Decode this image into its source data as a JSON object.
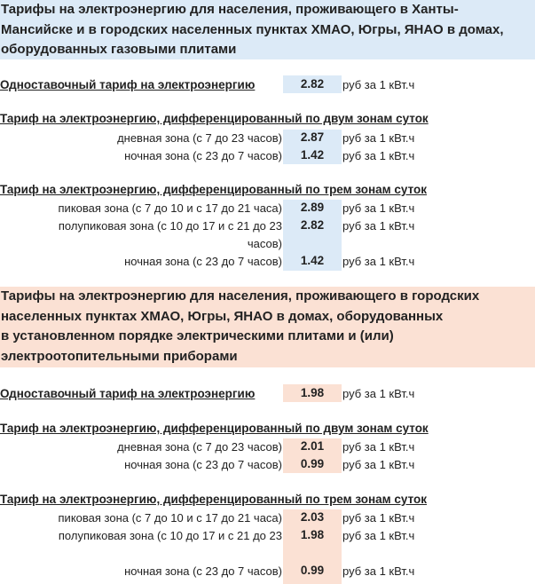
{
  "section1": {
    "title_lines": [
      "Тарифы на электроэнергию для населения, проживающего в Ханты-",
      "Мансийске и в городских населенных пунктах ХМАО, Югры, ЯНАО в домах,",
      "оборудованных газовыми плитами"
    ],
    "single": {
      "heading": "Одноставочный тариф на электроэнергию",
      "value": "2.82",
      "unit": "руб за 1 кВт.ч"
    },
    "two_zone": {
      "heading": "Тариф на электроэнергию, дифференцированный по двум зонам суток",
      "rows": [
        {
          "label": "дневная зона (с 7 до 23 часов)",
          "value": "2.87",
          "unit": "руб за 1 кВт.ч"
        },
        {
          "label": "ночная зона (с 23 до 7 часов)",
          "value": "1.42",
          "unit": "руб за 1 кВт.ч"
        }
      ]
    },
    "three_zone": {
      "heading": "Тариф на электроэнергию, дифференцированный по трем зонам суток",
      "rows": [
        {
          "label": "пиковая зона (с 7 до 10 и с 17 до 21 часа)",
          "value": "2.89",
          "unit": "руб за 1 кВт.ч"
        },
        {
          "label": "полупиковая зона (с 10 до 17 и с 21 до 23 часов)",
          "value": "2.82",
          "unit": "руб за 1 кВт.ч"
        },
        {
          "label": "ночная зона (с 23 до 7 часов)",
          "value": "1.42",
          "unit": "руб за 1 кВт.ч"
        }
      ]
    }
  },
  "section2": {
    "title_lines": [
      "Тарифы на электроэнергию для населения, проживающего в городских",
      "населенных пунктах ХМАО, Югры, ЯНАО в домах, оборудованных",
      "в установленном порядке электрическими плитами и (или)",
      "электроотопительными приборами"
    ],
    "single": {
      "heading": "Одноставочный тариф на электроэнергию",
      "value": "1.98",
      "unit": "руб за 1 кВт.ч"
    },
    "two_zone": {
      "heading": "Тариф на электроэнергию, дифференцированный по двум зонам суток",
      "rows": [
        {
          "label": "дневная зона (с 7 до 23 часов)",
          "value": "2.01",
          "unit": "руб за 1 кВт.ч"
        },
        {
          "label": "ночная зона (с 23 до 7 часов)",
          "value": "0.99",
          "unit": "руб за 1 кВт.ч"
        }
      ]
    },
    "three_zone": {
      "heading": "Тариф на электроэнергию, дифференцированный по трем зонам суток",
      "rows": [
        {
          "label": "пиковая зона (с 7 до 10 и с 17 до 21 часа)",
          "value": "2.03",
          "unit": "руб за 1 кВт.ч"
        },
        {
          "label": "полупиковая зона (с 10 до 17 и с 21 до 23",
          "value": "1.98",
          "unit": "руб за 1 кВт.ч"
        },
        {
          "label": "ночная зона (с 23 до 7 часов)",
          "value": "0.99",
          "unit": "руб за 1 кВт.ч"
        }
      ]
    }
  },
  "colors": {
    "blue_bg": "#dceaf7",
    "peach_bg": "#fbe1d4"
  }
}
